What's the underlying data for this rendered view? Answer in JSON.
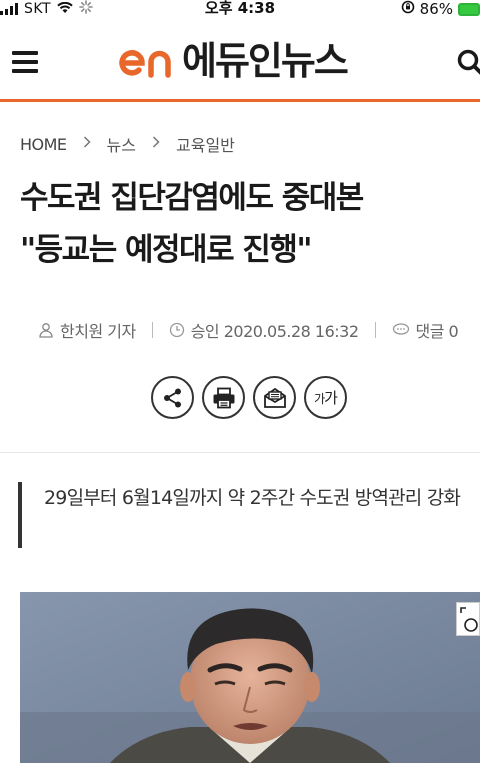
{
  "status_bar": {
    "carrier": "SKT",
    "time": "오후 4:38",
    "battery": "86%"
  },
  "header": {
    "logo_mark": "EN",
    "logo_text": "에듀인뉴스"
  },
  "breadcrumb": {
    "items": [
      "HOME",
      "뉴스",
      "교육일반"
    ]
  },
  "article": {
    "title_line1": "수도권 집단감염에도 중대본",
    "title_line2": "\"등교는 예정대로 진행\"",
    "reporter": "한치원 기자",
    "approved": "승인 2020.05.28 16:32",
    "comments": "댓글 0",
    "font_size_label_small": "가",
    "font_size_label_large": "가",
    "subtitle": "29일부터 6월14일까지 약 2주간 수도권 방역관리 강화"
  },
  "colors": {
    "accent": "#e8672b",
    "battery": "#34c940"
  }
}
